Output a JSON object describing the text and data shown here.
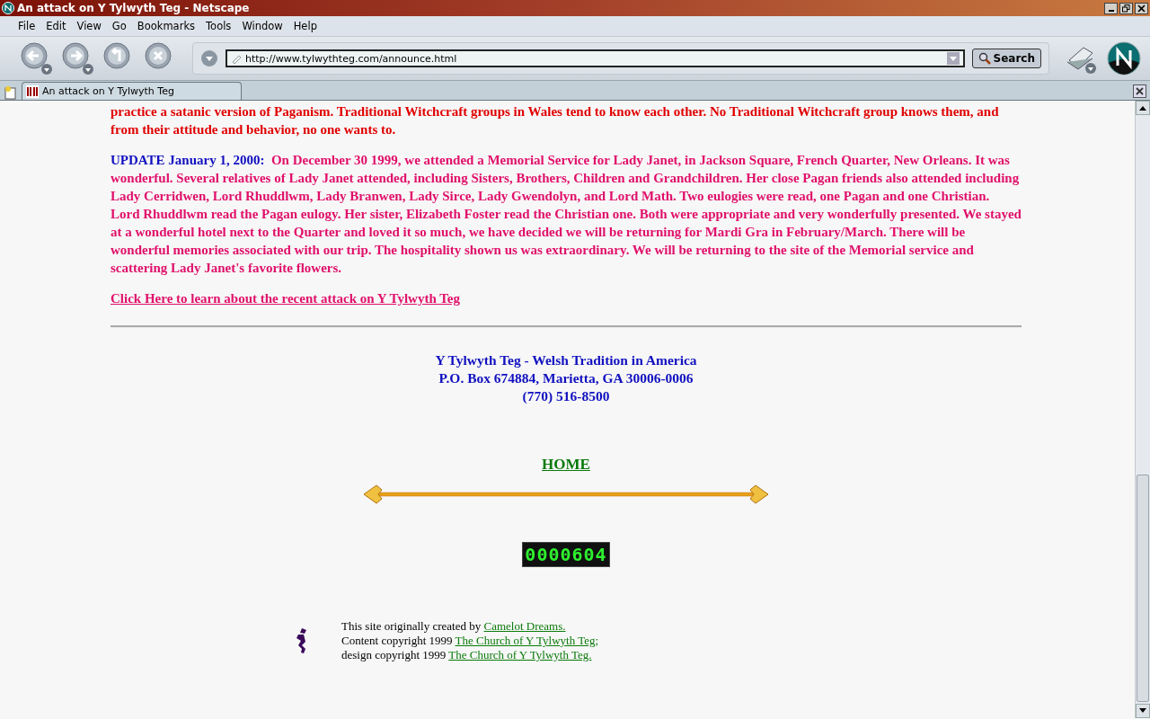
{
  "window": {
    "title": "An attack on Y Tylwyth Teg - Netscape"
  },
  "menu": [
    "File",
    "Edit",
    "View",
    "Go",
    "Bookmarks",
    "Tools",
    "Window",
    "Help"
  ],
  "toolbar": {
    "url": "http://www.tylwythteg.com/announce.html",
    "search_button": "Search"
  },
  "tabs": [
    {
      "label": "An attack on Y Tylwyth Teg",
      "selected": true
    }
  ],
  "page": {
    "intro": "practice a satanic version of Paganism.  Traditional Witchcraft groups in Wales tend to know each other.  No Traditional Witchcraft group knows them, and from their attitude and behavior, no one wants to.",
    "update_label": "UPDATE  January 1, 2000:",
    "update_text": "On December 30 1999, we attended a Memorial Service for Lady Janet, in Jackson Square, French Quarter, New Orleans.  It was wonderful.  Several relatives of Lady Janet attended, including Sisters, Brothers, Children and Grandchildren.  Her close Pagan friends also attended including Lady Cerridwen, Lord Rhuddlwm, Lady Branwen, Lady Sirce, Lady Gwendolyn, and Lord Math.  Two eulogies were read, one Pagan and one Christian.  Lord Rhuddlwm read the Pagan eulogy.  Her sister, Elizabeth Foster read the Christian one.  Both were appropriate and very wonderfully presented.  We stayed at a wonderful hotel next to the Quarter and loved it so much, we have decided we will be returning for Mardi Gra in February/March.  There will be wonderful memories associated with our trip.  The hospitality shown us was extraordinary.  We will be returning to the site of the Memorial service and scattering Lady Janet's favorite flowers.",
    "attack_link": "Click Here to learn about the recent attack on Y Tylwyth Teg",
    "address": [
      "Y Tylwyth Teg - Welsh Tradition in America",
      "P.O. Box 674884, Marietta, GA 30006-0006",
      "(770) 516-8500"
    ],
    "home_link": "HOME",
    "counter": "0000604",
    "credits": [
      {
        "text": "This site originally created by",
        "link": "Camelot Dreams."
      },
      {
        "text": "Content copyright 1999",
        "link": "The Church of Y Tylwyth Teg;"
      },
      {
        "text": "design copyright 1999",
        "link": "The Church of Y Tylwyth Teg."
      }
    ]
  }
}
